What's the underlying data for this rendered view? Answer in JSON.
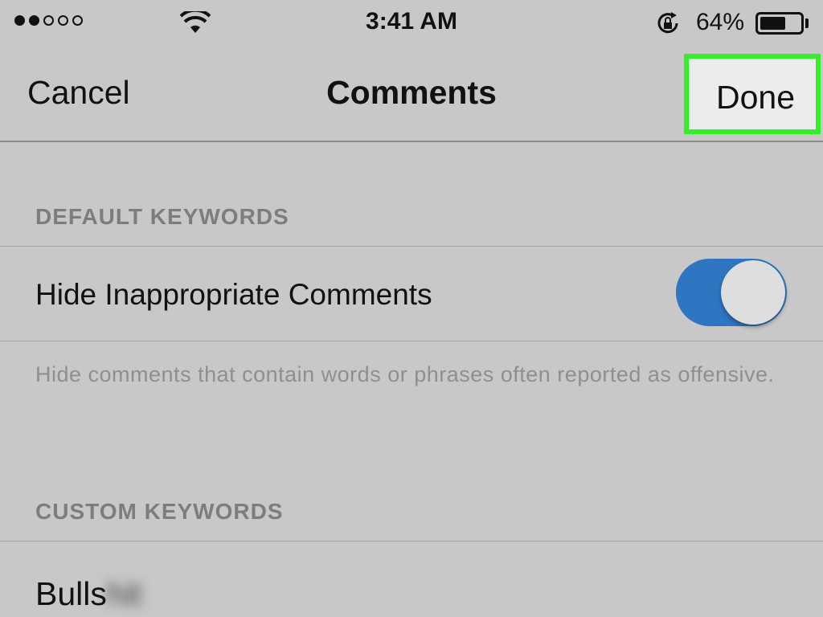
{
  "status_bar": {
    "signal_filled": 2,
    "signal_total": 5,
    "time": "3:41 AM",
    "battery_percent": "64%",
    "battery_level": 0.64
  },
  "nav": {
    "cancel_label": "Cancel",
    "title": "Comments",
    "done_label": "Done",
    "highlight_color": "#35ee2b"
  },
  "default_keywords": {
    "header": "DEFAULT KEYWORDS",
    "hide_label": "Hide Inappropriate Comments",
    "toggle_on": true,
    "toggle_color": "#2f76c2",
    "footnote": "Hide comments that contain words or phrases often reported as offensive."
  },
  "custom_keywords": {
    "header": "CUSTOM KEYWORDS",
    "first_keyword_visible": "Bulls",
    "first_keyword_blurred": "hit"
  },
  "icons": [
    "wifi-icon",
    "orientation-lock-icon",
    "battery-icon"
  ]
}
